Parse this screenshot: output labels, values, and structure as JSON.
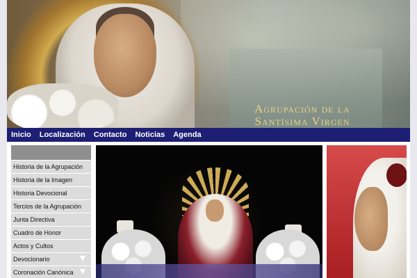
{
  "header": {
    "title_line1": "Agrupación de la",
    "title_line2": "Santísima Virgen"
  },
  "nav": {
    "items": [
      "Inicio",
      "Localización",
      "Contacto",
      "Noticias",
      "Agenda"
    ]
  },
  "sidebar": {
    "items": [
      {
        "label": "Historia de la Agrupación",
        "has_submenu": false
      },
      {
        "label": "Historia de la Imagen",
        "has_submenu": false
      },
      {
        "label": "Historia Devocional",
        "has_submenu": false
      },
      {
        "label": "Tercios de la Agrupación",
        "has_submenu": false
      },
      {
        "label": "Junta Directiva",
        "has_submenu": false
      },
      {
        "label": "Cuadro de Honor",
        "has_submenu": false
      },
      {
        "label": "Actos y Cultos",
        "has_submenu": false
      },
      {
        "label": "Devocionario",
        "has_submenu": true
      },
      {
        "label": "Coronación Canónica",
        "has_submenu": true
      }
    ]
  },
  "colors": {
    "nav_bg": "#1c1f73",
    "title_gold": "#e7d38a",
    "sidebar_head": "#8f8f8f",
    "sidebar_item": "#dcdcdc"
  }
}
